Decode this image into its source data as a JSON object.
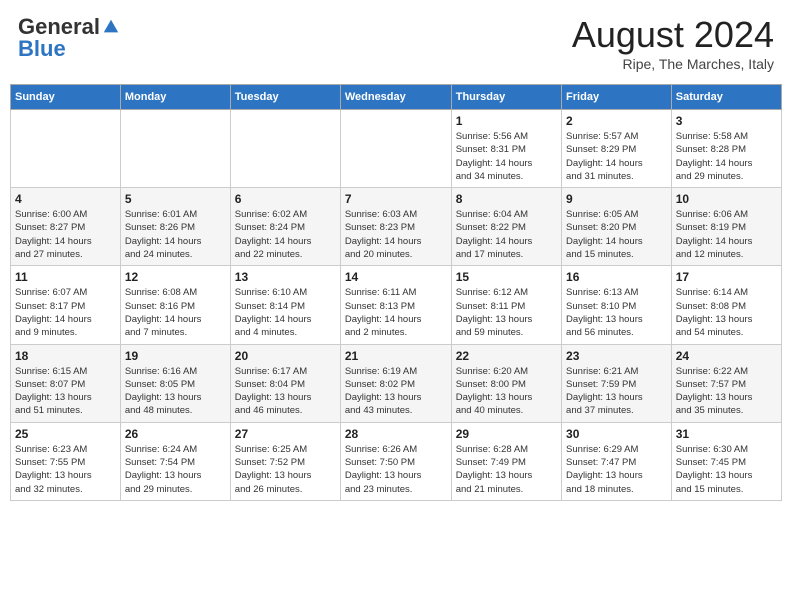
{
  "header": {
    "logo_general": "General",
    "logo_blue": "Blue",
    "month_year": "August 2024",
    "location": "Ripe, The Marches, Italy"
  },
  "days_of_week": [
    "Sunday",
    "Monday",
    "Tuesday",
    "Wednesday",
    "Thursday",
    "Friday",
    "Saturday"
  ],
  "weeks": [
    [
      {
        "day": "",
        "detail": ""
      },
      {
        "day": "",
        "detail": ""
      },
      {
        "day": "",
        "detail": ""
      },
      {
        "day": "",
        "detail": ""
      },
      {
        "day": "1",
        "detail": "Sunrise: 5:56 AM\nSunset: 8:31 PM\nDaylight: 14 hours\nand 34 minutes."
      },
      {
        "day": "2",
        "detail": "Sunrise: 5:57 AM\nSunset: 8:29 PM\nDaylight: 14 hours\nand 31 minutes."
      },
      {
        "day": "3",
        "detail": "Sunrise: 5:58 AM\nSunset: 8:28 PM\nDaylight: 14 hours\nand 29 minutes."
      }
    ],
    [
      {
        "day": "4",
        "detail": "Sunrise: 6:00 AM\nSunset: 8:27 PM\nDaylight: 14 hours\nand 27 minutes."
      },
      {
        "day": "5",
        "detail": "Sunrise: 6:01 AM\nSunset: 8:26 PM\nDaylight: 14 hours\nand 24 minutes."
      },
      {
        "day": "6",
        "detail": "Sunrise: 6:02 AM\nSunset: 8:24 PM\nDaylight: 14 hours\nand 22 minutes."
      },
      {
        "day": "7",
        "detail": "Sunrise: 6:03 AM\nSunset: 8:23 PM\nDaylight: 14 hours\nand 20 minutes."
      },
      {
        "day": "8",
        "detail": "Sunrise: 6:04 AM\nSunset: 8:22 PM\nDaylight: 14 hours\nand 17 minutes."
      },
      {
        "day": "9",
        "detail": "Sunrise: 6:05 AM\nSunset: 8:20 PM\nDaylight: 14 hours\nand 15 minutes."
      },
      {
        "day": "10",
        "detail": "Sunrise: 6:06 AM\nSunset: 8:19 PM\nDaylight: 14 hours\nand 12 minutes."
      }
    ],
    [
      {
        "day": "11",
        "detail": "Sunrise: 6:07 AM\nSunset: 8:17 PM\nDaylight: 14 hours\nand 9 minutes."
      },
      {
        "day": "12",
        "detail": "Sunrise: 6:08 AM\nSunset: 8:16 PM\nDaylight: 14 hours\nand 7 minutes."
      },
      {
        "day": "13",
        "detail": "Sunrise: 6:10 AM\nSunset: 8:14 PM\nDaylight: 14 hours\nand 4 minutes."
      },
      {
        "day": "14",
        "detail": "Sunrise: 6:11 AM\nSunset: 8:13 PM\nDaylight: 14 hours\nand 2 minutes."
      },
      {
        "day": "15",
        "detail": "Sunrise: 6:12 AM\nSunset: 8:11 PM\nDaylight: 13 hours\nand 59 minutes."
      },
      {
        "day": "16",
        "detail": "Sunrise: 6:13 AM\nSunset: 8:10 PM\nDaylight: 13 hours\nand 56 minutes."
      },
      {
        "day": "17",
        "detail": "Sunrise: 6:14 AM\nSunset: 8:08 PM\nDaylight: 13 hours\nand 54 minutes."
      }
    ],
    [
      {
        "day": "18",
        "detail": "Sunrise: 6:15 AM\nSunset: 8:07 PM\nDaylight: 13 hours\nand 51 minutes."
      },
      {
        "day": "19",
        "detail": "Sunrise: 6:16 AM\nSunset: 8:05 PM\nDaylight: 13 hours\nand 48 minutes."
      },
      {
        "day": "20",
        "detail": "Sunrise: 6:17 AM\nSunset: 8:04 PM\nDaylight: 13 hours\nand 46 minutes."
      },
      {
        "day": "21",
        "detail": "Sunrise: 6:19 AM\nSunset: 8:02 PM\nDaylight: 13 hours\nand 43 minutes."
      },
      {
        "day": "22",
        "detail": "Sunrise: 6:20 AM\nSunset: 8:00 PM\nDaylight: 13 hours\nand 40 minutes."
      },
      {
        "day": "23",
        "detail": "Sunrise: 6:21 AM\nSunset: 7:59 PM\nDaylight: 13 hours\nand 37 minutes."
      },
      {
        "day": "24",
        "detail": "Sunrise: 6:22 AM\nSunset: 7:57 PM\nDaylight: 13 hours\nand 35 minutes."
      }
    ],
    [
      {
        "day": "25",
        "detail": "Sunrise: 6:23 AM\nSunset: 7:55 PM\nDaylight: 13 hours\nand 32 minutes."
      },
      {
        "day": "26",
        "detail": "Sunrise: 6:24 AM\nSunset: 7:54 PM\nDaylight: 13 hours\nand 29 minutes."
      },
      {
        "day": "27",
        "detail": "Sunrise: 6:25 AM\nSunset: 7:52 PM\nDaylight: 13 hours\nand 26 minutes."
      },
      {
        "day": "28",
        "detail": "Sunrise: 6:26 AM\nSunset: 7:50 PM\nDaylight: 13 hours\nand 23 minutes."
      },
      {
        "day": "29",
        "detail": "Sunrise: 6:28 AM\nSunset: 7:49 PM\nDaylight: 13 hours\nand 21 minutes."
      },
      {
        "day": "30",
        "detail": "Sunrise: 6:29 AM\nSunset: 7:47 PM\nDaylight: 13 hours\nand 18 minutes."
      },
      {
        "day": "31",
        "detail": "Sunrise: 6:30 AM\nSunset: 7:45 PM\nDaylight: 13 hours\nand 15 minutes."
      }
    ]
  ]
}
